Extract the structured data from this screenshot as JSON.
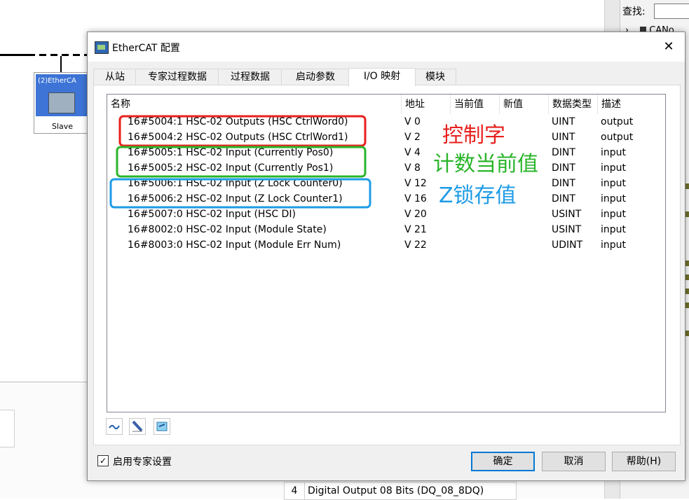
{
  "background": {
    "slave_node_label": "(2)EtherCA",
    "slave_caption": "Slave",
    "find_label": "查找:",
    "tree_item": "CANo",
    "bottom_row": {
      "index": "4",
      "text": "Digital Output 08 Bits (DQ_08_8DQ)"
    }
  },
  "dialog": {
    "title": "EtherCAT 配置",
    "close_label": "✕",
    "tabs": [
      {
        "label": "从站"
      },
      {
        "label": "专家过程数据"
      },
      {
        "label": "过程数据"
      },
      {
        "label": "启动参数"
      },
      {
        "label": "I/O 映射"
      },
      {
        "label": "模块"
      }
    ],
    "active_tab": "I/O 映射",
    "columns": [
      "名称",
      "地址",
      "当前值",
      "新值",
      "数据类型",
      "描述"
    ],
    "rows": [
      {
        "name": "16#5004:1 HSC-02 Outputs (HSC CtrlWord0)",
        "address": "V 0",
        "type": "UINT",
        "desc": "output"
      },
      {
        "name": "16#5004:2 HSC-02 Outputs (HSC CtrlWord1)",
        "address": "V 2",
        "type": "UINT",
        "desc": "output"
      },
      {
        "name": "16#5005:1 HSC-02 Input (Currently Pos0)",
        "address": "V 4",
        "type": "DINT",
        "desc": "input"
      },
      {
        "name": "16#5005:2 HSC-02 Input (Currently Pos1)",
        "address": "V 8",
        "type": "DINT",
        "desc": "input"
      },
      {
        "name": "16#5006:1 HSC-02 Input (Z Lock Counter0)",
        "address": "V 12",
        "type": "DINT",
        "desc": "input"
      },
      {
        "name": "16#5006:2 HSC-02 Input (Z Lock Counter1)",
        "address": "V 16",
        "type": "DINT",
        "desc": "input"
      },
      {
        "name": "16#5007:0 HSC-02 Input (HSC DI)",
        "address": "V 20",
        "type": "USINT",
        "desc": "input"
      },
      {
        "name": "16#8002:0 HSC-02 Input (Module State)",
        "address": "V 21",
        "type": "USINT",
        "desc": "input"
      },
      {
        "name": "16#8003:0 HSC-02 Input (Module Err Num)",
        "address": "V 22",
        "type": "UDINT",
        "desc": "input"
      }
    ],
    "annotations": [
      {
        "text": "控制字",
        "color": "#e8201c"
      },
      {
        "text": "计数当前值",
        "color": "#2ab52a"
      },
      {
        "text": "Z锁存值",
        "color": "#1e9be6"
      }
    ],
    "toolbar_icons": [
      "map-variable-icon",
      "edit-icon",
      "refresh-icon"
    ],
    "expert_checkbox": {
      "checked": true,
      "label": "启用专家设置"
    },
    "buttons": {
      "ok": "确定",
      "cancel": "取消",
      "help": "帮助(H)"
    }
  }
}
